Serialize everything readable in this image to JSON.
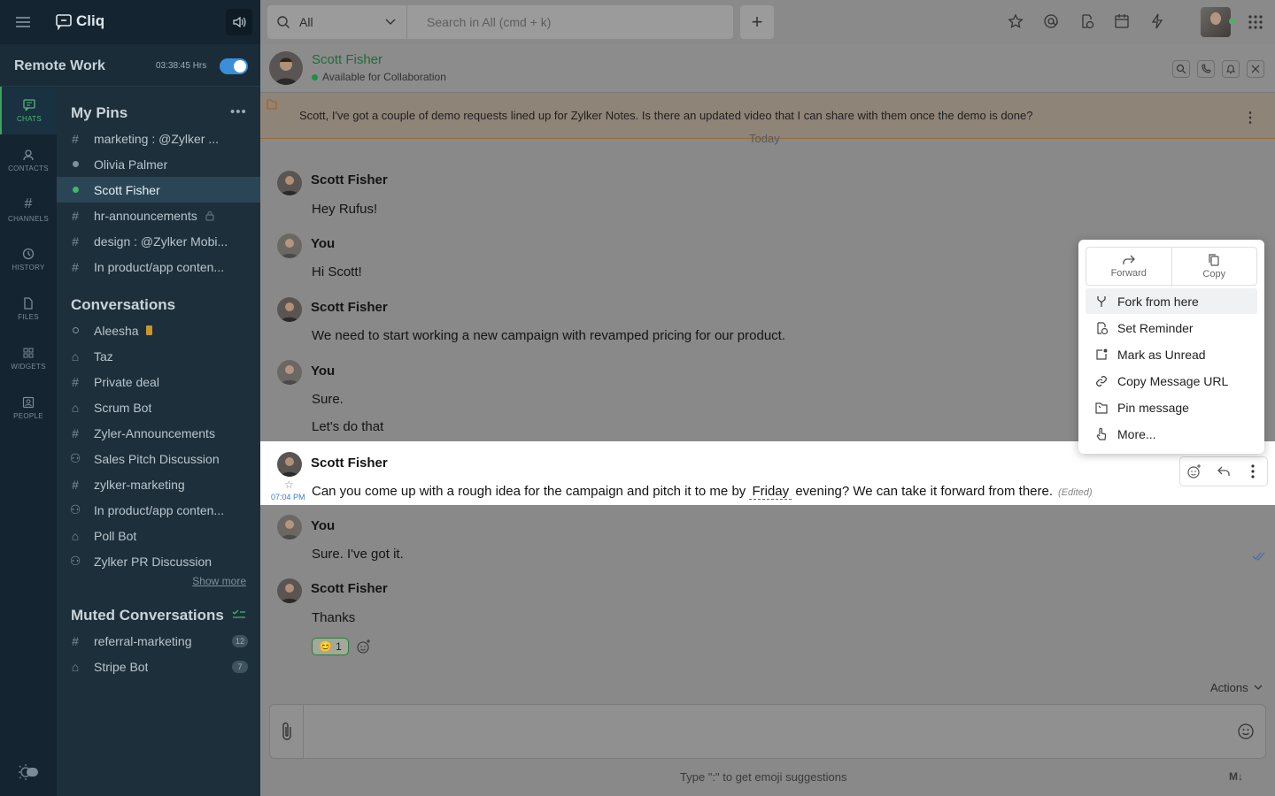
{
  "app": {
    "name": "Cliq"
  },
  "workspace": {
    "title": "Remote Work",
    "timer": "03:38:45 Hrs"
  },
  "nav": [
    {
      "label": "CHATS",
      "icon": "chat-icon"
    },
    {
      "label": "CONTACTS",
      "icon": "contacts-icon"
    },
    {
      "label": "CHANNELS",
      "icon": "hash-icon"
    },
    {
      "label": "HISTORY",
      "icon": "history-icon"
    },
    {
      "label": "FILES",
      "icon": "file-icon"
    },
    {
      "label": "WIDGETS",
      "icon": "widgets-icon"
    },
    {
      "label": "PEOPLE",
      "icon": "people-icon"
    }
  ],
  "sidebar": {
    "pins_title": "My Pins",
    "pins": [
      {
        "name": "marketing : @Zylker ...",
        "kind": "channel"
      },
      {
        "name": "Olivia Palmer",
        "kind": "user"
      },
      {
        "name": "Scott Fisher",
        "kind": "user-online"
      },
      {
        "name": "hr-announcements",
        "kind": "channel-locked"
      },
      {
        "name": "design : @Zylker Mobi...",
        "kind": "channel"
      },
      {
        "name": "In product/app conten...",
        "kind": "channel"
      }
    ],
    "conv_title": "Conversations",
    "conversations": [
      {
        "name": "Aleesha",
        "kind": "user-away"
      },
      {
        "name": "Taz",
        "kind": "bot"
      },
      {
        "name": "Private deal",
        "kind": "channel"
      },
      {
        "name": "Scrum Bot",
        "kind": "bot"
      },
      {
        "name": "Zyler-Announcements",
        "kind": "channel"
      },
      {
        "name": "Sales Pitch Discussion",
        "kind": "group"
      },
      {
        "name": "zylker-marketing",
        "kind": "channel"
      },
      {
        "name": "In product/app conten...",
        "kind": "group"
      },
      {
        "name": "Poll Bot",
        "kind": "bot"
      },
      {
        "name": "Zylker PR Discussion",
        "kind": "group"
      }
    ],
    "show_more": "Show more",
    "muted_title": "Muted Conversations",
    "muted": [
      {
        "name": "referral-marketing",
        "kind": "channel",
        "count": "12"
      },
      {
        "name": "Stripe Bot",
        "kind": "bot",
        "count": "7"
      }
    ]
  },
  "search": {
    "scope": "All",
    "placeholder": "Search in All (cmd + k)"
  },
  "chat": {
    "name": "Scott Fisher",
    "status": "Available for Collaboration",
    "pinned": "Scott, I've got a couple of demo requests lined up for Zylker Notes. Is there an updated video that I can share with them once the demo is done?",
    "day": "Today",
    "messages": [
      {
        "sender": "Scott Fisher",
        "lines": [
          "Hey Rufus!"
        ]
      },
      {
        "sender": "You",
        "lines": [
          "Hi Scott!"
        ]
      },
      {
        "sender": "Scott Fisher",
        "lines": [
          "We need to start working a new campaign with revamped pricing for our product."
        ]
      },
      {
        "sender": "You",
        "lines": [
          "Sure.",
          "Let's do that"
        ]
      },
      {
        "sender": "Scott Fisher",
        "time": "07:04 PM",
        "text_before": "Can you come up with a rough idea for the campaign and pitch it to me by",
        "highlight": "Friday",
        "text_after": "evening? We can take it forward from there.",
        "edited": "(Edited)"
      },
      {
        "sender": "You",
        "lines": [
          "Sure. I've got it."
        ]
      },
      {
        "sender": "Scott Fisher",
        "lines": [
          "Thanks"
        ],
        "reaction": {
          "emoji": "😊",
          "count": "1"
        }
      }
    ]
  },
  "context_menu": {
    "top": [
      {
        "label": "Forward"
      },
      {
        "label": "Copy"
      }
    ],
    "items": [
      {
        "label": "Fork from here"
      },
      {
        "label": "Set Reminder"
      },
      {
        "label": "Mark as Unread"
      },
      {
        "label": "Copy Message URL"
      },
      {
        "label": "Pin message"
      },
      {
        "label": "More..."
      }
    ]
  },
  "composer": {
    "actions": "Actions",
    "hint": "Type \":\" to get emoji suggestions",
    "markdown": "M↓"
  }
}
